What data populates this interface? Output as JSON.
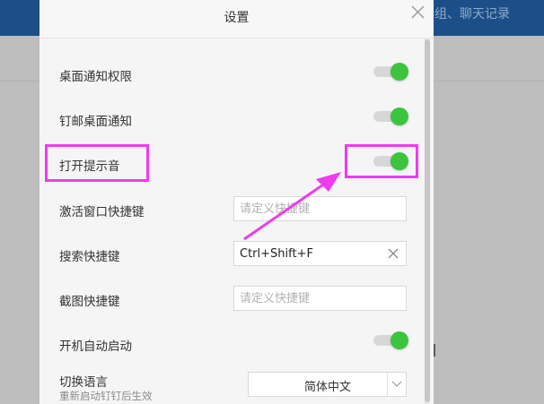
{
  "background": {
    "topbar_text": "详组、聊天记录",
    "topbar_color": "#1c4f88"
  },
  "dialog": {
    "title": "设置",
    "close_icon": "close-icon"
  },
  "settings": {
    "desktop_notify_permission": {
      "label": "桌面通知权限",
      "enabled": true
    },
    "dingmail_desktop_notify": {
      "label": "钉邮桌面通知",
      "enabled": true
    },
    "enable_sound": {
      "label": "打开提示音",
      "enabled": true
    },
    "activate_window_shortcut": {
      "label": "激活窗口快捷键",
      "value": "",
      "placeholder": "请定义快捷键"
    },
    "search_shortcut": {
      "label": "搜索快捷键",
      "value": "Ctrl+Shift+F",
      "placeholder": ""
    },
    "screenshot_shortcut": {
      "label": "截图快捷键",
      "value": "",
      "placeholder": "请定义快捷键"
    },
    "auto_start": {
      "label": "开机自动启动",
      "enabled": true
    },
    "language": {
      "label": "切换语言",
      "hint": "重新启动钉钉后生效",
      "selected": "简体中文"
    }
  },
  "colors": {
    "toggle_on": "#3cc43c",
    "annotation": "#ee3bee"
  }
}
